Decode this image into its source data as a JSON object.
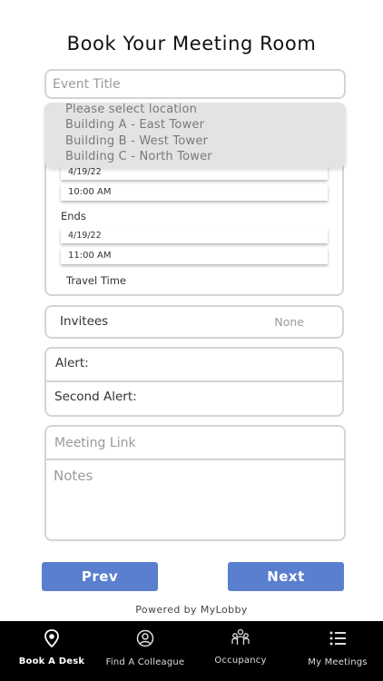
{
  "page_title": "Book Your Meeting Room",
  "event_title_placeholder": "Event Title",
  "location_dropdown": {
    "options": [
      "Please select location",
      "Building A - East Tower",
      "Building B - West Tower",
      "Building C - North Tower"
    ]
  },
  "schedule": {
    "start_date": "4/19/22",
    "start_time": "10:00 AM",
    "ends_label": "Ends",
    "end_date": "4/19/22",
    "end_time": "11:00 AM",
    "travel_time_label": "Travel Time"
  },
  "invitees": {
    "label": "Invitees",
    "value": "None"
  },
  "alerts": {
    "alert_label": "Alert:",
    "second_alert_label": "Second Alert:"
  },
  "meeting_link_placeholder": "Meeting Link",
  "notes_placeholder": "Notes",
  "buttons": {
    "prev": "Prev",
    "next": "Next"
  },
  "footer": "Powered by MyLobby",
  "tabbar": {
    "items": [
      {
        "label": "Book A Desk",
        "icon": "location-pin-icon",
        "active": true
      },
      {
        "label": "Find A Colleague",
        "icon": "person-circle-icon",
        "active": false
      },
      {
        "label": "Occupancy",
        "icon": "group-icon",
        "active": false
      },
      {
        "label": "My Meetings",
        "icon": "list-icon",
        "active": false
      }
    ]
  },
  "colors": {
    "button": "#5b7fcf",
    "tabbar": "#000000",
    "dropdown_bg": "#e3e3e3",
    "border": "#d4d4d4"
  }
}
